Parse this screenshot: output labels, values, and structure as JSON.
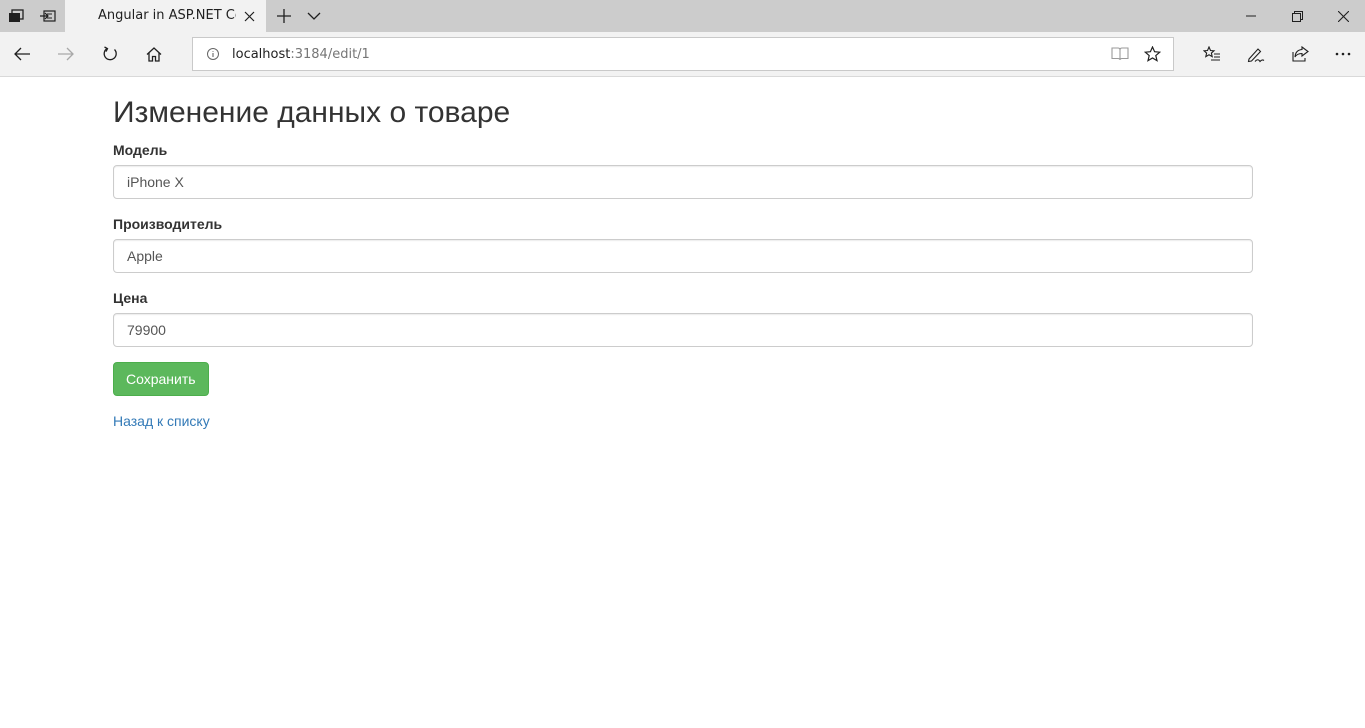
{
  "browser": {
    "tab_title": "Angular in ASP.NET Cor",
    "address": {
      "host": "localhost",
      "path": ":3184/edit/1"
    }
  },
  "page": {
    "title": "Изменение данных о товаре",
    "fields": {
      "model": {
        "label": "Модель",
        "value": "iPhone X"
      },
      "manufacturer": {
        "label": "Производитель",
        "value": "Apple"
      },
      "price": {
        "label": "Цена",
        "value": "79900"
      }
    },
    "save_label": "Сохранить",
    "back_label": "Назад к списку"
  },
  "colors": {
    "save_button": "#5cb85c",
    "link": "#337ab7",
    "tab_strip": "#cccccc",
    "toolbar": "#f2f2f2"
  },
  "icons": [
    "tab-preview-icon",
    "set-aside-tabs-icon",
    "close-icon",
    "new-tab-icon",
    "chevron-down-icon",
    "minimize-icon",
    "restore-icon",
    "back-arrow-icon",
    "forward-arrow-icon",
    "refresh-icon",
    "home-icon",
    "info-icon",
    "reading-view-icon",
    "star-icon",
    "favorites-icon",
    "pen-icon",
    "share-icon",
    "more-icon"
  ]
}
